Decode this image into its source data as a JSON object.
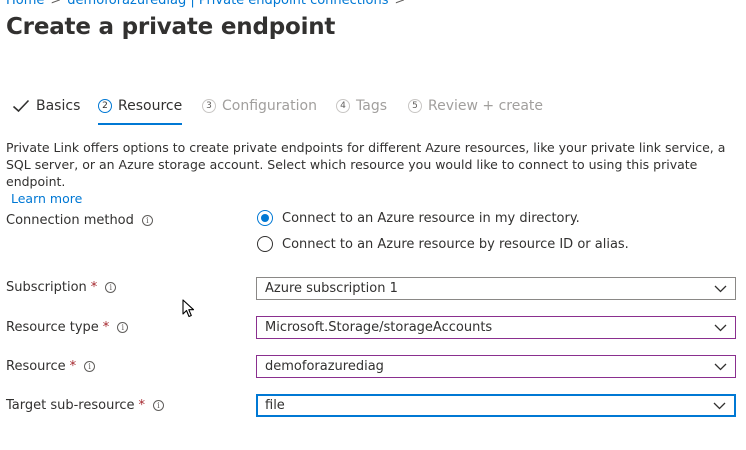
{
  "breadcrumb": {
    "items": [
      "Home",
      "demoforazurediag | Private endpoint connections"
    ],
    "separator": ">"
  },
  "page": {
    "title": "Create a private endpoint"
  },
  "steps": [
    {
      "number": "",
      "label": "Basics",
      "state": "done",
      "icon": "checkmark-icon"
    },
    {
      "number": "2",
      "label": "Resource",
      "state": "active"
    },
    {
      "number": "3",
      "label": "Configuration",
      "state": "disabled"
    },
    {
      "number": "4",
      "label": "Tags",
      "state": "disabled"
    },
    {
      "number": "5",
      "label": "Review + create",
      "state": "disabled"
    }
  ],
  "description": {
    "text": "Private Link offers options to create private endpoints for different Azure resources, like your private link service, a SQL server, or an Azure storage account. Select which resource you would like to connect to using this private endpoint.",
    "learn_more": "Learn more"
  },
  "form": {
    "connection_method": {
      "label": "Connection method",
      "options": [
        "Connect to an Azure resource in my directory.",
        "Connect to an Azure resource by resource ID or alias."
      ],
      "selected_index": 0
    },
    "subscription": {
      "label": "Subscription",
      "required": "*",
      "value": "Azure subscription 1"
    },
    "resource_type": {
      "label": "Resource type",
      "required": "*",
      "value": "Microsoft.Storage/storageAccounts"
    },
    "resource": {
      "label": "Resource",
      "required": "*",
      "value": "demoforazurediag"
    },
    "target_sub_resource": {
      "label": "Target sub-resource",
      "required": "*",
      "value": "file"
    }
  },
  "colors": {
    "accent": "#0078d4",
    "required": "#a4262c",
    "highlight_border": "#8a2f8f",
    "text": "#323130",
    "disabled": "#a19f9d"
  }
}
